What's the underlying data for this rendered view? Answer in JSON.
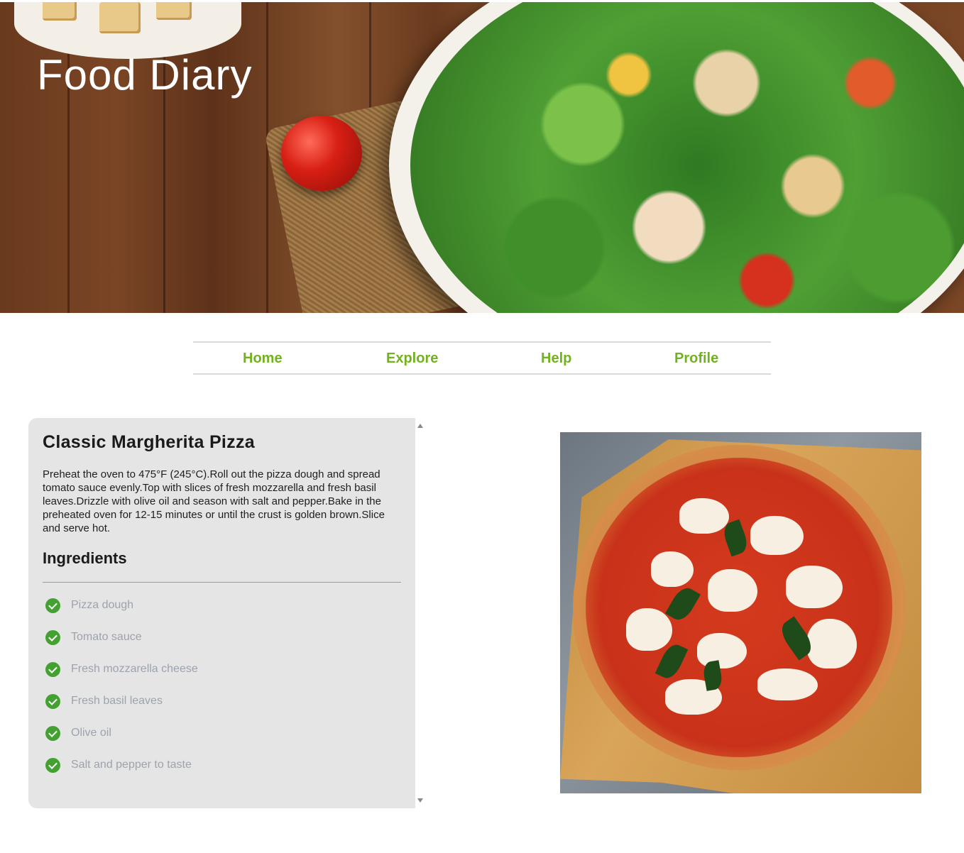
{
  "site": {
    "title": "Food Diary"
  },
  "nav": {
    "items": [
      {
        "label": "Home"
      },
      {
        "label": "Explore"
      },
      {
        "label": "Help"
      },
      {
        "label": "Profile"
      }
    ]
  },
  "recipe": {
    "title": "Classic Margherita Pizza",
    "description": "Preheat the oven to 475°F (245°C).Roll out the pizza dough and spread tomato sauce evenly.Top with slices of fresh mozzarella and fresh basil leaves.Drizzle with olive oil and season with salt and pepper.Bake in the preheated oven for 12-15 minutes or until the crust is golden brown.Slice and serve hot.",
    "ingredients_heading": "Ingredients",
    "ingredients": [
      "Pizza dough",
      "Tomato sauce",
      "Fresh mozzarella cheese",
      "Fresh basil leaves",
      "Olive oil",
      "Salt and pepper to taste"
    ]
  },
  "colors": {
    "nav_accent": "#73b21f",
    "check_green": "#43a132",
    "card_background": "#e5e5e5",
    "ingredient_text": "#9da3ad"
  },
  "icons": {
    "ingredient_marker": "check-circle-icon",
    "scroll_up": "scroll-up-arrow-icon",
    "scroll_down": "scroll-down-arrow-icon"
  }
}
